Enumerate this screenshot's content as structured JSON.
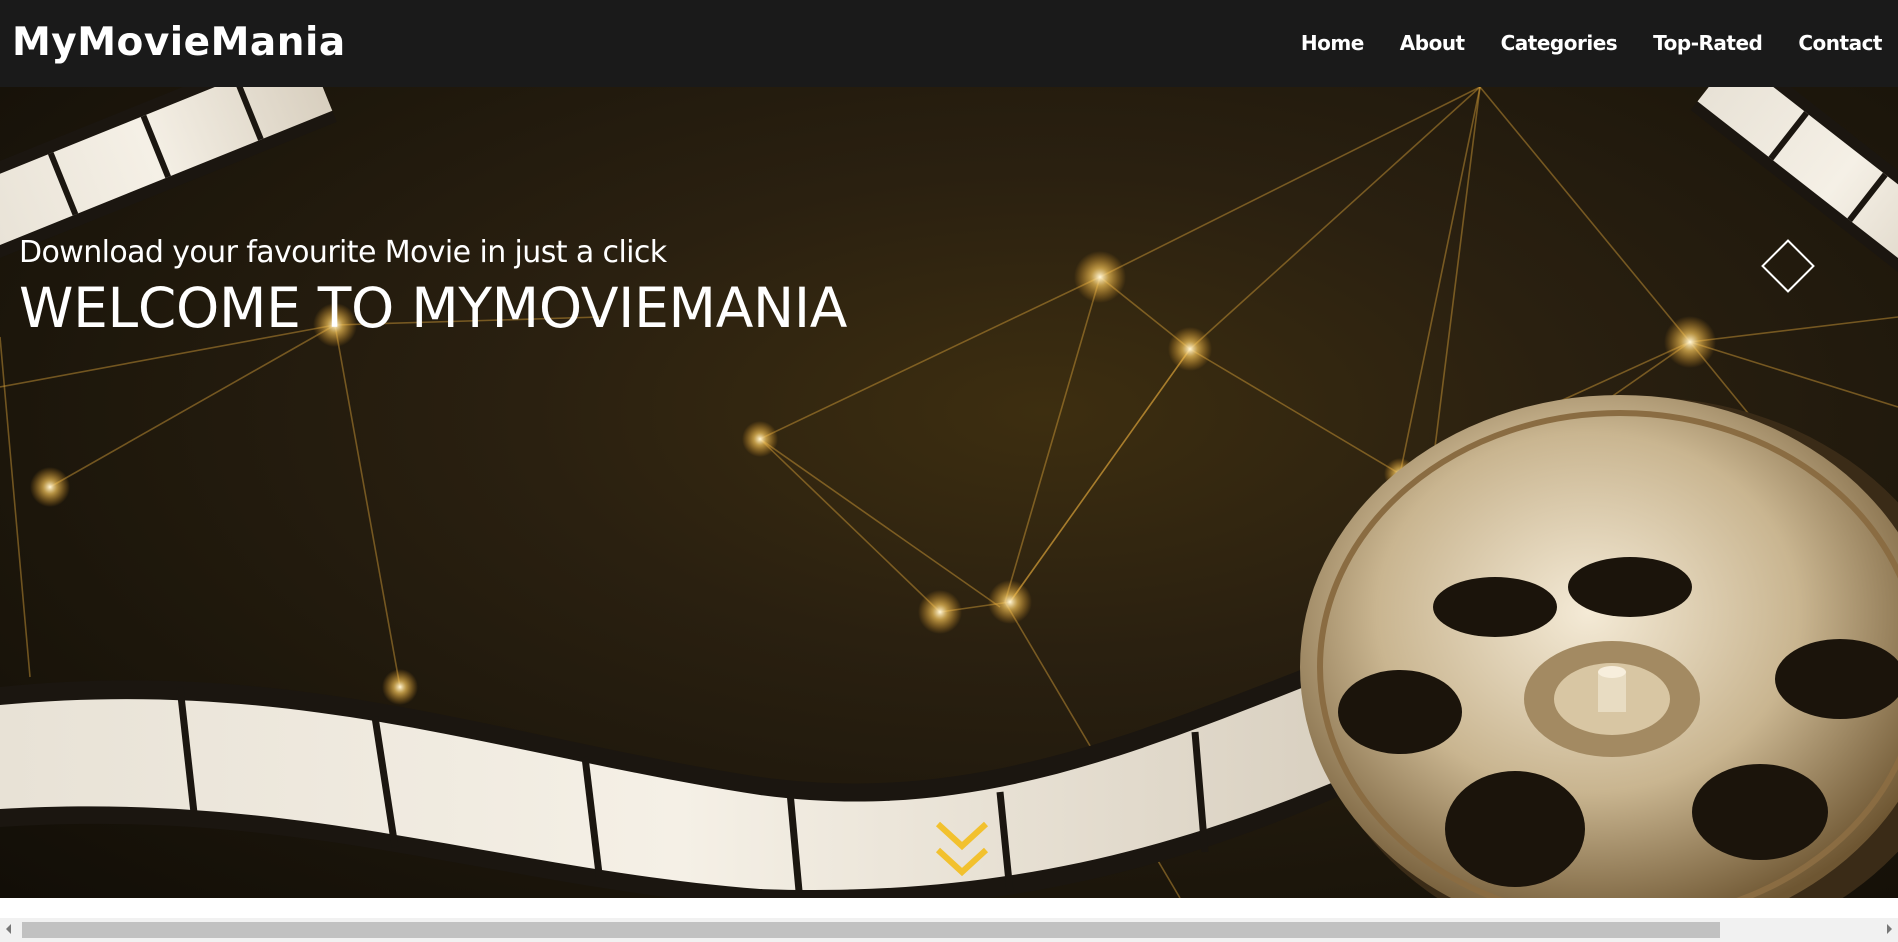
{
  "brand": "MyMovieMania",
  "nav": {
    "items": [
      "Home",
      "About",
      "Categories",
      "Top-Rated",
      "Contact"
    ]
  },
  "hero": {
    "subtitle": "Download your favourite Movie in just a click",
    "title": "WELCOME TO MYMOVIEMANIA",
    "next_icon": "diamond-icon",
    "scroll_icon": "double-chevron-down-icon"
  },
  "colors": {
    "navbar": "#1a1a1a",
    "accent": "#f2c12e",
    "text": "#ffffff"
  }
}
